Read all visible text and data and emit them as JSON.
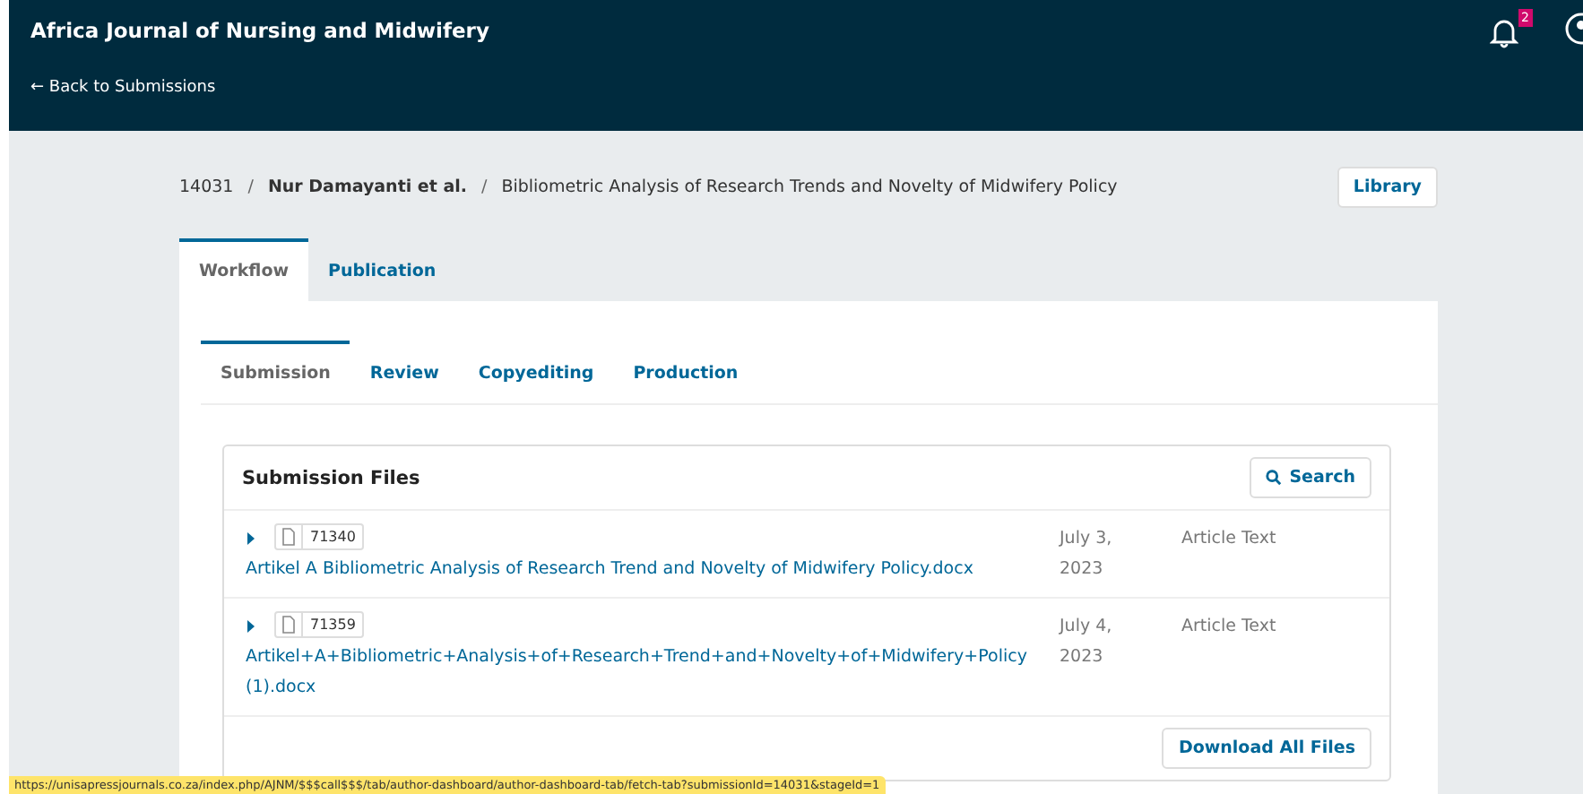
{
  "header": {
    "journal_title": "Africa Journal of Nursing and Midwifery",
    "back_link": "← Back to Submissions",
    "notification_count": "2"
  },
  "breadcrumb": {
    "separator": "/",
    "id": "14031",
    "authors": "Nur Damayanti et al.",
    "title": "Bibliometric Analysis of Research Trends and Novelty of Midwifery Policy"
  },
  "library_button": "Library",
  "tabs": [
    {
      "label": "Workflow",
      "selected": true
    },
    {
      "label": "Publication",
      "selected": false
    }
  ],
  "stage_tabs": [
    {
      "label": "Submission",
      "selected": true
    },
    {
      "label": "Review",
      "selected": false
    },
    {
      "label": "Copyediting",
      "selected": false
    },
    {
      "label": "Production",
      "selected": false
    }
  ],
  "files": {
    "title": "Submission Files",
    "search_button": "Search",
    "download_button": "Download All Files",
    "rows": [
      {
        "id": "71340",
        "name": "Artikel A Bibliometric Analysis of Research Trend and Novelty of Midwifery Policy.docx",
        "date": "July 3, 2023",
        "type": "Article Text"
      },
      {
        "id": "71359",
        "name": "Artikel+A+Bibliometric+Analysis+of+Research+Trend+and+Novelty+of+Midwifery+Policy (1).docx",
        "date": "July 4, 2023",
        "type": "Article Text"
      }
    ]
  },
  "status_url": "https://unisapressjournals.co.za/index.php/AJNM/$$$call$$$/tab/author-dashboard/author-dashboard-tab/fetch-tab?submissionId=14031&stageId=1"
}
